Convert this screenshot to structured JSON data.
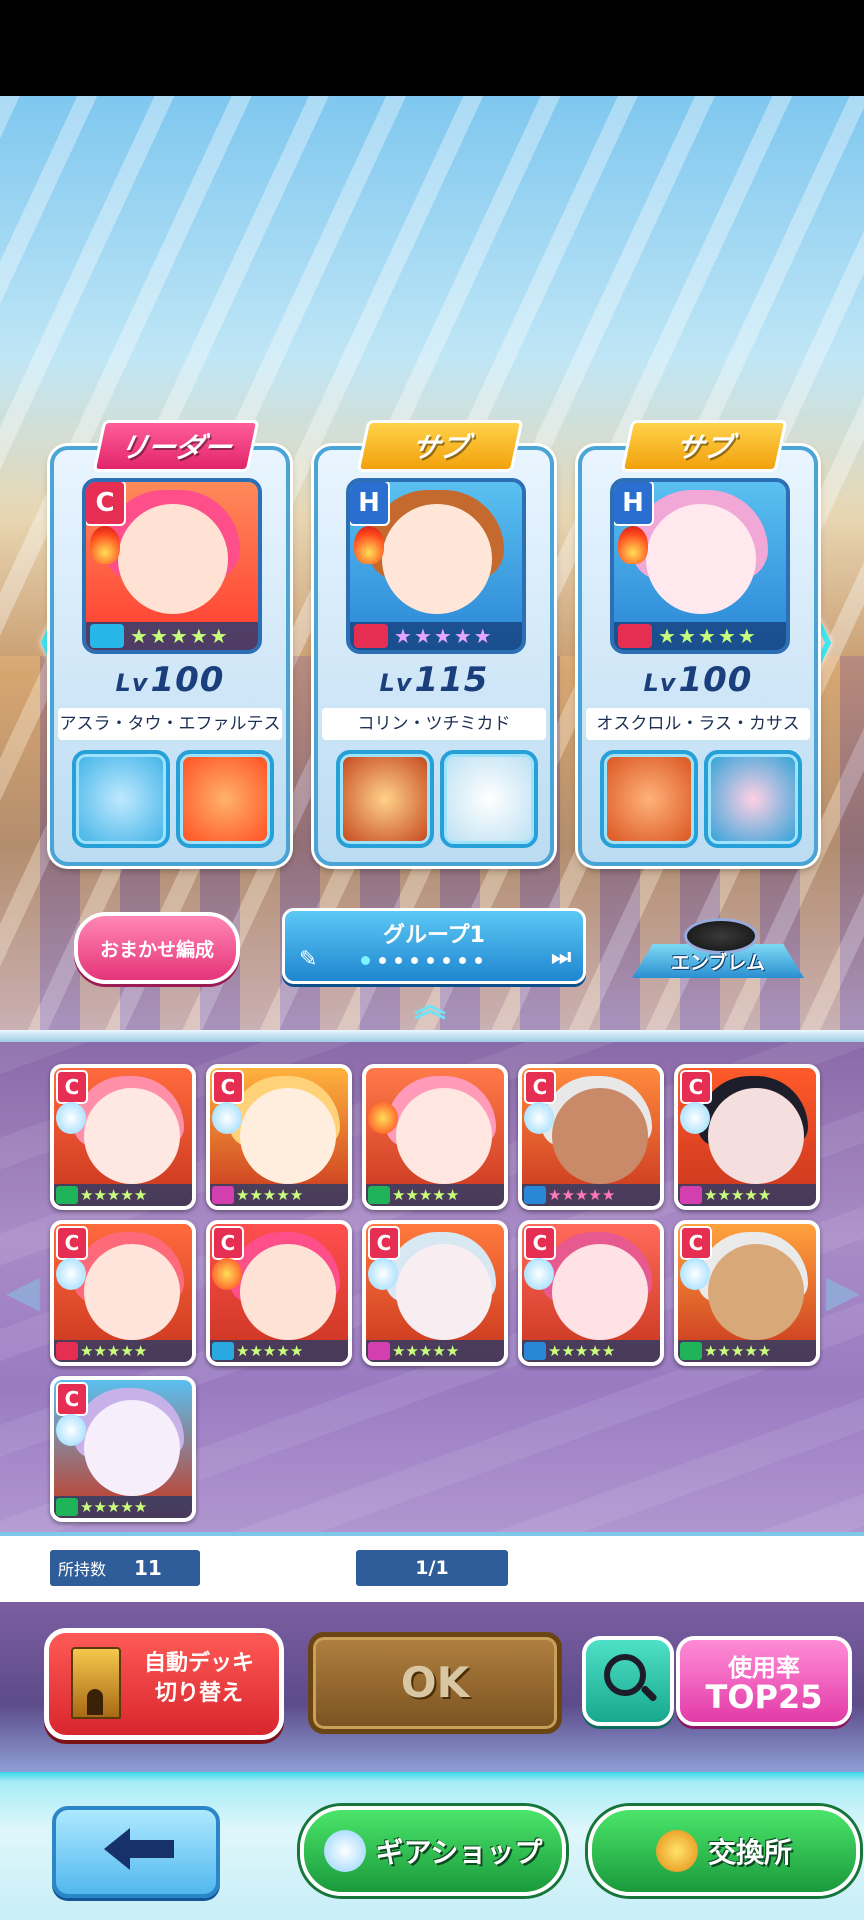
{
  "deck": {
    "slots": [
      {
        "role": "リーダー",
        "rank": "C",
        "level_prefix": "Lv",
        "level": "100",
        "name": "アスラ・タウ・エファルテス",
        "stars": 5
      },
      {
        "role": "サブ",
        "rank": "H",
        "level_prefix": "Lv",
        "level": "115",
        "name": "コリン・ツチミカド",
        "stars": 5
      },
      {
        "role": "サブ",
        "rank": "H",
        "level_prefix": "Lv",
        "level": "100",
        "name": "オスクロル・ラス・カサス",
        "stars": 5
      }
    ],
    "prev_arrow": "《",
    "next_arrow": "》"
  },
  "controls": {
    "auto_form_label": "おまかせ編成",
    "group_name": "グループ1",
    "group_pages": 8,
    "group_current": 1,
    "pencil_icon": "✎",
    "last_icon": "⏭",
    "emblem_label": "エンブレム",
    "expand_icon": "︽"
  },
  "units": [
    {
      "rank": "C",
      "stars": 5
    },
    {
      "rank": "C",
      "stars": 5
    },
    {
      "rank": "",
      "stars": 5
    },
    {
      "rank": "C",
      "stars": 5
    },
    {
      "rank": "C",
      "stars": 5
    },
    {
      "rank": "C",
      "stars": 5
    },
    {
      "rank": "C",
      "stars": 5
    },
    {
      "rank": "C",
      "stars": 5
    },
    {
      "rank": "C",
      "stars": 5
    },
    {
      "rank": "C",
      "stars": 5
    },
    {
      "rank": "C",
      "stars": 5
    }
  ],
  "info": {
    "owned_label": "所持数",
    "owned_count": "11",
    "page": "1/1"
  },
  "actions": {
    "auto_deck_label": "自動デッキ\n切り替え",
    "ok_label": "OK",
    "top25_line1": "使用率",
    "top25_line2": "TOP25"
  },
  "nav": {
    "gear_shop_label": "ギアショップ",
    "exchange_label": "交換所"
  },
  "colors": {
    "leader_tag": "#e2256b",
    "sub_tag": "#f2a10c",
    "rank_c": "#e62e52",
    "rank_h": "#2a6fd0",
    "star": "#c8ff7a",
    "nav_green": "#1a9a3c"
  }
}
